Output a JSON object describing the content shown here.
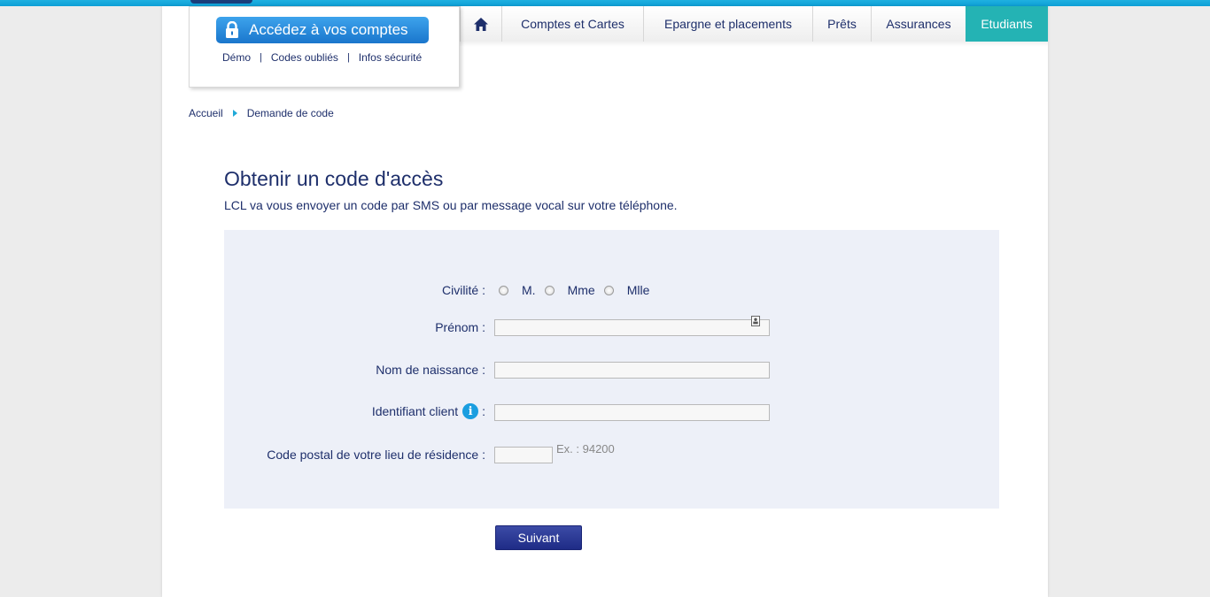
{
  "login": {
    "button_label": "Accédez à vos comptes",
    "links": [
      "Démo",
      "Codes oubliés",
      "Infos sécurité"
    ]
  },
  "nav": {
    "items": [
      "Comptes et Cartes",
      "Epargne et placements",
      "Prêts",
      "Assurances",
      "Etudiants"
    ],
    "active": "Etudiants"
  },
  "breadcrumb": [
    "Accueil",
    "Demande de code"
  ],
  "page": {
    "title": "Obtenir un code d'accès",
    "description": "LCL va vous envoyer un code par SMS ou par message vocal sur votre téléphone."
  },
  "form": {
    "civilite_label": "Civilité :",
    "civilite_options": [
      "M.",
      "Mme",
      "Mlle"
    ],
    "prenom_label": "Prénom :",
    "prenom_value": "",
    "nom_label": "Nom de naissance :",
    "nom_value": "",
    "identifiant_label": "Identifiant client",
    "identifiant_colon": ":",
    "identifiant_value": "",
    "postal_label": "Code postal de votre lieu de résidence :",
    "postal_value": "",
    "postal_hint": "Ex. : 94200",
    "submit_label": "Suivant"
  },
  "colors": {
    "brand_navy": "#1e2f6b",
    "accent_cyan": "#20a9d8",
    "active_tab": "#24b3b4",
    "panel_bg": "#edf0f8"
  },
  "icons": [
    "lock-icon",
    "home-icon",
    "breadcrumb-arrow-icon",
    "contact-card-icon",
    "info-icon"
  ]
}
